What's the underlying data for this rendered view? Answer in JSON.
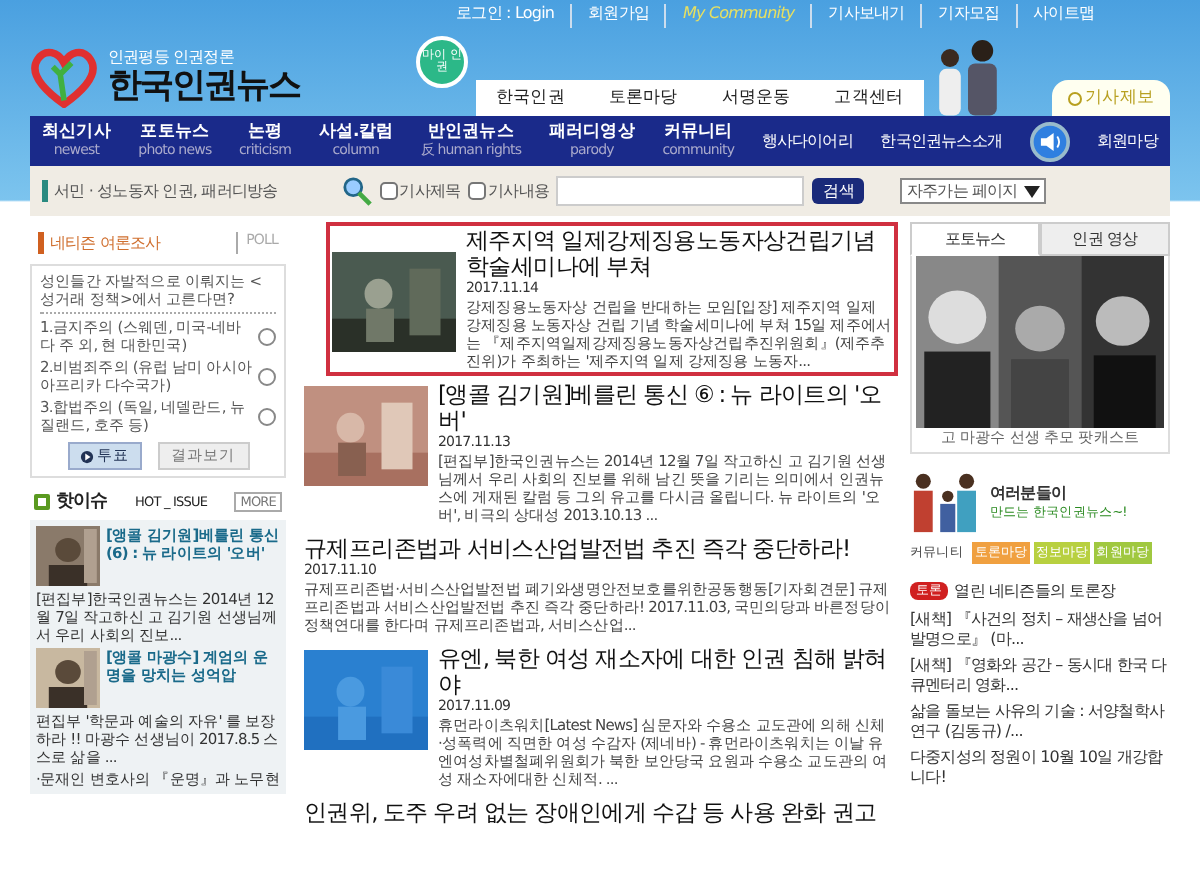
{
  "top_links": [
    "로그인 : Login",
    "회원가입",
    "My Community",
    "기사보내기",
    "기자모집",
    "사이트맵"
  ],
  "logo": {
    "slogan": "인권평등 인권정론",
    "name": "한국인권뉴스"
  },
  "my_badge": "마이 인권",
  "top_tabs": [
    "한국인권",
    "토론마당",
    "서명운동",
    "고객센터"
  ],
  "report_tab": "기사제보",
  "nav": [
    {
      "label": "최신기사",
      "sub": "newest"
    },
    {
      "label": "포토뉴스",
      "sub": "photo news"
    },
    {
      "label": "논평",
      "sub": "criticism"
    },
    {
      "label": "사설.칼럼",
      "sub": "column"
    },
    {
      "label": "반인권뉴스",
      "sub": "反 human rights"
    },
    {
      "label": "패러디영상",
      "sub": "parody"
    },
    {
      "label": "커뮤니티",
      "sub": "community"
    }
  ],
  "nav_extra": [
    "행사다이어리",
    "한국인권뉴스소개"
  ],
  "member_link": "회원마당",
  "search": {
    "tagline": "서민 · 성노동자 인권, 패러디방송",
    "options": [
      {
        "label": "기사제목",
        "checked": false
      },
      {
        "label": "기사내용",
        "checked": false
      }
    ],
    "button": "검색",
    "select": "자주가는 페이지"
  },
  "poll": {
    "title": "네티즌 여론조사",
    "tag": "POLL",
    "question": "성인들간 자발적으로 이뤄지는 <성거래 정책>에서 고른다면?",
    "options": [
      {
        "label": "1.금지주의 (스웨덴, 미국-네바다 주 외, 현 대한민국)",
        "selected": false
      },
      {
        "label": "2.비범죄주의 (유럽 남미 아시아 아프리카 다수국가)",
        "selected": false
      },
      {
        "label": "3.합법주의 (독일, 네델란드, 뉴질랜드, 호주 등)",
        "selected": false
      }
    ],
    "vote": "투표",
    "results": "결과보기"
  },
  "hot": {
    "title": "핫이슈",
    "tag": "HOT _ ISSUE",
    "more": "MORE",
    "items": [
      {
        "title": "[앵콜 김기원]베를린 통신 (6) : 뉴 라이트의 '오버'",
        "summary": "[편집부]한국인권뉴스는 2014년 12월 7일 작고하신 고 김기원 선생님께서 우리 사회의 진보..."
      },
      {
        "title": "[앵콜 마광수] 계엄의 운명을 망치는 성억압",
        "summary": "편집부 '학문과 예술의 자유' 를 보장하라 !! 마광수 선생님이 2017.8.5 스스로 삶을 ..."
      }
    ],
    "link": "·문재인 변호사의 『운명』과 노무현"
  },
  "articles": [
    {
      "title": "제주지역 일제강제징용노동자상건립기념 학술세미나에 부쳐",
      "date": "2017.11.14",
      "summary": "강제징용노동자상 건립을 반대하는 모임[입장] 제주지역 일제 강제징용 노동자상 건립 기념 학술세미나에 부쳐 15일 제주에서는 『제주지역일제강제징용노동자상건립추진위원회』(제주추진위)가 주최하는 '제주지역 일제 강제징용 노동자...",
      "thumb": true,
      "selected": true
    },
    {
      "title": "[앵콜 김기원]베를린 통신 ⑥ : 뉴 라이트의 '오버'",
      "date": "2017.11.13",
      "summary": "[편집부]한국인권뉴스는 2014년 12월 7일 작고하신 고 김기원 선생님께서 우리 사회의 진보를 위해 남긴 뜻을 기리는 의미에서 인권뉴스에 게재된 칼럼 등 그의 유고를 다시금 올립니다. 뉴 라이트의 '오버', 비극의 상대성 2013.10.13 ...",
      "thumb": true,
      "selected": false
    },
    {
      "title": "규제프리존법과 서비스산업발전법 추진 즉각 중단하라!",
      "date": "2017.11.10",
      "summary": "규제프리존법·서비스산업발전법 폐기와생명안전보호를위한공동행동[기자회견문] 규제프리존법과 서비스산업발전법 추진 즉각 중단하라! 2017.11.03, 국민의당과 바른정당이 정책연대를 한다며 규제프리존법과, 서비스산업...",
      "thumb": false,
      "selected": false
    },
    {
      "title": "유엔, 북한 여성 재소자에 대한 인권 침해 밝혀야",
      "date": "2017.11.09",
      "summary": "휴먼라이츠워치[Latest News] 심문자와 수용소 교도관에 의해 신체 ·성폭력에 직면한 여성 수감자 (제네바) - 휴먼라이츠워치는 이날 유엔여성차별철폐위원회가 북한 보안당국 요원과 수용소 교도관의 여성 재소자에대한 신체적. ...",
      "thumb": true,
      "selected": false
    },
    {
      "title": "인권위, 도주 우려 없는 장애인에게 수갑 등 사용 완화 권고",
      "thumb": false,
      "selected": false
    }
  ],
  "media_tabs": [
    {
      "label": "포토뉴스",
      "selected": true
    },
    {
      "label": "인권 영상",
      "selected": false
    }
  ],
  "media_caption": "고 마광수 선생 추모 팟캐스트",
  "banner": {
    "title": "여러분들이",
    "sub": "만드는 한국인권뉴스~!"
  },
  "community": {
    "label": "커뮤니티",
    "links": [
      {
        "label": "토론마당",
        "color": "#f0a040"
      },
      {
        "label": "정보마당",
        "color": "#b8d040"
      },
      {
        "label": "회원마당",
        "color": "#a0c840"
      }
    ]
  },
  "forum": {
    "badge": "토론",
    "title": "열린 네티즌들의 토론장",
    "items": [
      "[새책] 『사건의 정치 – 재생산을 넘어 발명으로』 (마...",
      "[새책] 『영화와 공간 – 동시대 한국 다큐멘터리 영화...",
      "삶을 돌보는 사유의 기술 : 서양철학사 연구 (김동규) /...",
      "다중지성의 정원이 10월 10일 개강합니다!"
    ]
  }
}
